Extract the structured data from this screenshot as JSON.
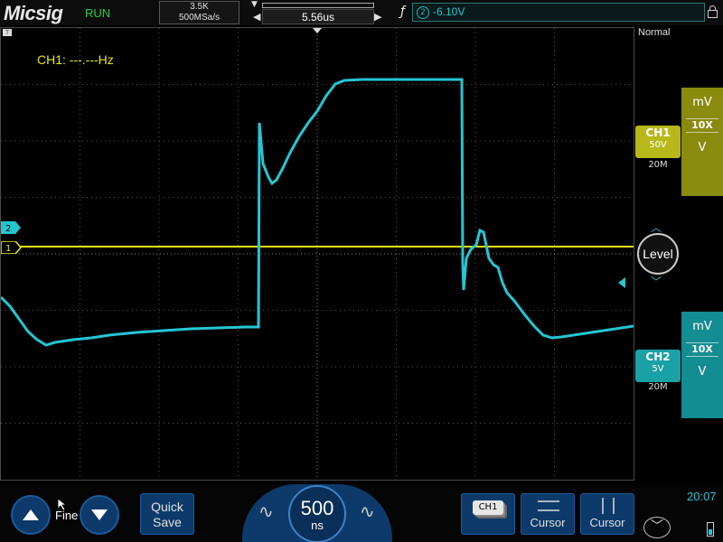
{
  "header": {
    "logo": "Micsig",
    "run_state": "RUN",
    "memory_depth": "3.5K",
    "sample_rate": "500MSa/s",
    "trigger_delay": "5.56us",
    "trigger_channel": "②",
    "trigger_level": "-6.10V"
  },
  "screen": {
    "frequency_readout": "CH1: ---.---Hz",
    "ch2_marker": "2",
    "ch1_marker": "1"
  },
  "right_panel": {
    "trigger_mode": "Normal",
    "ch1": {
      "name": "CH1",
      "volts": "50V",
      "bandwidth": "20M",
      "unit_top": "mV",
      "probe": "10X",
      "unit_bottom": "V"
    },
    "ch2": {
      "name": "CH2",
      "volts": "5V",
      "bandwidth": "20M",
      "unit_top": "mV",
      "probe": "10X",
      "unit_bottom": "V"
    },
    "level_label": "Level"
  },
  "bottom": {
    "fine_label": "Fine",
    "quick_save_line1": "Quick",
    "quick_save_line2": "Save",
    "timebase_value": "500",
    "timebase_unit": "ns",
    "ch1_menu_label": "CH1",
    "cursor1_label": "Cursor",
    "cursor2_label": "Cursor",
    "clock": "20:07"
  },
  "colors": {
    "ch1": "#e8e810",
    "ch2": "#25c6d3",
    "panel_blue": "#0d3a6a"
  },
  "icons": {
    "arrow_up": "arrow-up-icon",
    "arrow_down": "arrow-down-icon",
    "lock": "lock-icon",
    "battery": "battery-icon"
  }
}
